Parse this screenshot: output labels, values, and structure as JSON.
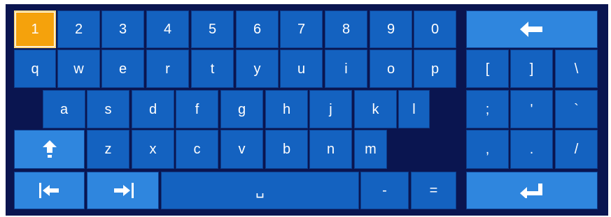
{
  "keyboard": {
    "focused_key": "1",
    "number_row": [
      "1",
      "2",
      "3",
      "4",
      "5",
      "6",
      "7",
      "8",
      "9",
      "0"
    ],
    "top_row": [
      "q",
      "w",
      "e",
      "r",
      "t",
      "y",
      "u",
      "i",
      "o",
      "p"
    ],
    "home_row": [
      "a",
      "s",
      "d",
      "f",
      "g",
      "h",
      "j",
      "k",
      "l"
    ],
    "bottom_row": [
      "z",
      "x",
      "c",
      "v",
      "b",
      "n",
      "m"
    ],
    "punct_row1": [
      "[",
      "]",
      "\\"
    ],
    "punct_row2": [
      ";",
      "'",
      "`"
    ],
    "punct_row3": [
      ",",
      ".",
      "/"
    ],
    "minus": "-",
    "equals": "=",
    "space_symbol": "␣",
    "icons": {
      "backspace": "backspace-arrow-icon",
      "shift": "shift-arrow-icon",
      "cursor_left": "cursor-left-icon",
      "cursor_right": "cursor-right-icon",
      "enter": "enter-return-icon"
    },
    "colors": {
      "background": "#0a1550",
      "key": "#1462c0",
      "special_key": "#2f86de",
      "focused_key": "#f5a20c",
      "text": "#ffffff"
    }
  }
}
